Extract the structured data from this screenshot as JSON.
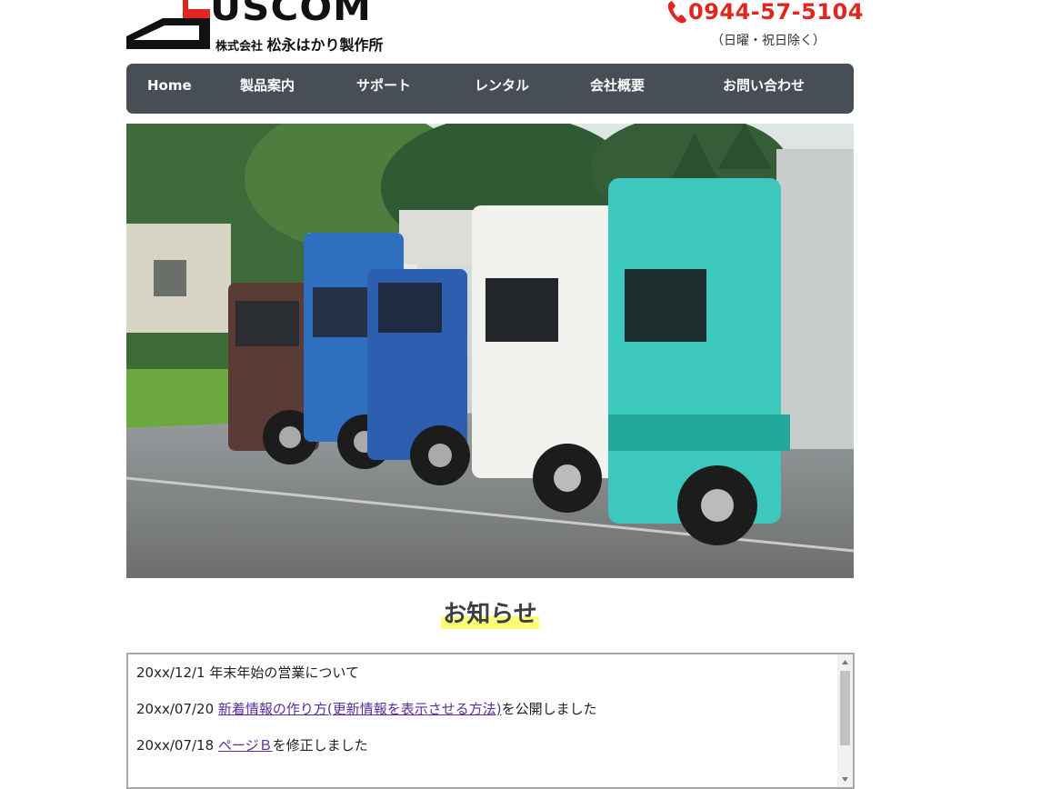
{
  "logo": {
    "wordmark": "USCOM",
    "company_prefix": "株式会社",
    "company_name": "松永はかり製作所"
  },
  "contact": {
    "phone_icon": "phone-icon",
    "phone_number": "0944-57-5104",
    "note": "（日曜・祝日除く）",
    "accent_color": "#e0261f"
  },
  "nav": {
    "background": "#474e55",
    "items": [
      {
        "label": "Home"
      },
      {
        "label": "製品案内"
      },
      {
        "label": "サポート"
      },
      {
        "label": "レンタル"
      },
      {
        "label": "会社概要"
      },
      {
        "label": "お問い合わせ"
      }
    ]
  },
  "hero": {
    "image": "parked-trucks-photo"
  },
  "news": {
    "title": "お知らせ",
    "items": [
      {
        "date": "20xx/12/1",
        "text": "年末年始の営業について",
        "link": "",
        "suffix": ""
      },
      {
        "date": "20xx/07/20",
        "text": "",
        "link": "新着情報の作り方(更新情報を表示させる方法)",
        "suffix": "を公開しました"
      },
      {
        "date": "20xx/07/18",
        "text": "",
        "link": "ページＢ",
        "suffix": "を修正しました"
      }
    ]
  }
}
